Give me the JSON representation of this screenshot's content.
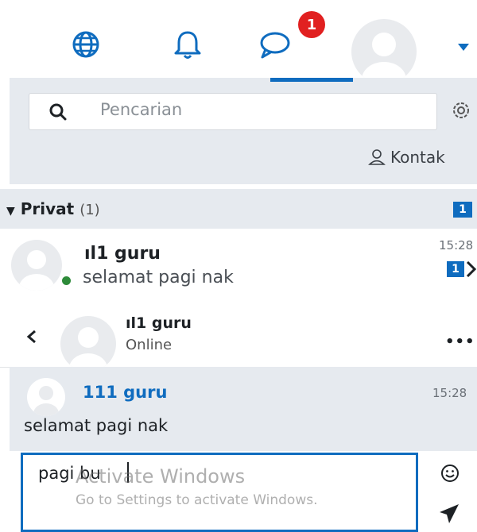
{
  "topbar": {
    "icons": [
      "language-globe-icon",
      "notifications-bell-icon",
      "messages-bubble-icon",
      "user-avatar",
      "user-menu-caret-icon"
    ],
    "messages_badge": "1",
    "accent_color": "#0f6cbf",
    "badge_color": "#e12020"
  },
  "search": {
    "placeholder": "Pencarian",
    "contacts_label": "Kontak"
  },
  "privat": {
    "label": "Privat",
    "count": "(1)",
    "unread_badge": "1"
  },
  "conversation": {
    "name": "ıl1 guru",
    "last_message": "selamat pagi nak",
    "time": "15:28",
    "unread": "1",
    "online": true
  },
  "chat": {
    "name": "ıl1 guru",
    "status": "Online",
    "more_label": "•••"
  },
  "message": {
    "sender": "111 guru",
    "time": "15:28",
    "text": "selamat pagi nak"
  },
  "compose": {
    "value": "pagi bu"
  },
  "watermark": {
    "line1": "Activate Windows",
    "line2": "Go to Settings to activate Windows."
  }
}
